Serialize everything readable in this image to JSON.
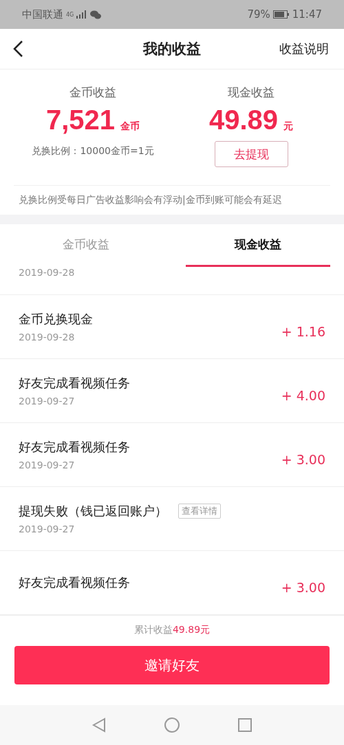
{
  "status_bar": {
    "carrier": "中国联通",
    "network": "4G",
    "battery": "79%",
    "time": "11:47"
  },
  "header": {
    "title": "我的收益",
    "action": "收益说明"
  },
  "summary": {
    "coin": {
      "label": "金币收益",
      "amount": "7,521",
      "unit": "金币",
      "note": "兑换比例：10000金币=1元"
    },
    "cash": {
      "label": "现金收益",
      "amount": "49.89",
      "unit": "元",
      "button": "去提现"
    },
    "notice": "兑换比例受每日广告收益影响会有浮动|金币到账可能会有延迟"
  },
  "tabs": [
    {
      "label": "金币收益",
      "selected": false
    },
    {
      "label": "现金收益",
      "selected": true
    }
  ],
  "records": [
    {
      "kind": "partial",
      "date": "2019-09-28"
    },
    {
      "kind": "entry",
      "title": "金币兑换现金",
      "date": "2019-09-28",
      "amount": "+ 1.16"
    },
    {
      "kind": "entry",
      "title": "好友完成看视频任务",
      "date": "2019-09-27",
      "amount": "+ 4.00"
    },
    {
      "kind": "entry",
      "title": "好友完成看视频任务",
      "date": "2019-09-27",
      "amount": "+ 3.00"
    },
    {
      "kind": "detail",
      "title": "提现失败（钱已返回账户）",
      "tag": "查看详情",
      "date": "2019-09-27"
    },
    {
      "kind": "entry",
      "title": "好友完成看视频任务",
      "amount": "+ 3.00"
    }
  ],
  "footer": {
    "total_label": "累计收益",
    "total": "49.89元",
    "button": "邀请好友"
  }
}
